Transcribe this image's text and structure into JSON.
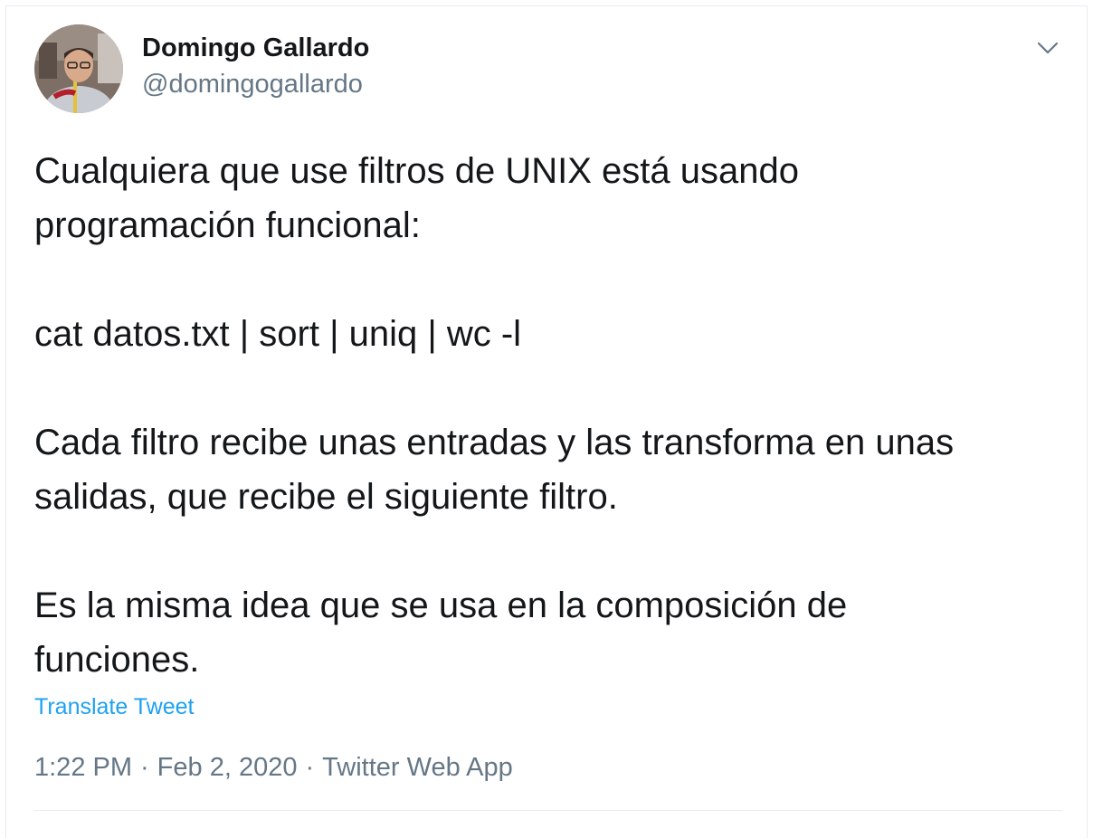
{
  "author": {
    "name": "Domingo Gallardo",
    "handle": "@domingogallardo"
  },
  "tweet": {
    "paragraphs": [
      [
        "Cualquiera que use filtros de UNIX está usando",
        "programación funcional:"
      ],
      [
        "cat datos.txt | sort | uniq | wc -l"
      ],
      [
        "Cada filtro recibe unas entradas y las transforma en unas",
        "salidas, que recibe el siguiente filtro."
      ],
      [
        "Es la misma idea que se usa en la composición de",
        "funciones."
      ]
    ],
    "translate_label": "Translate Tweet"
  },
  "meta": {
    "time": "1:22 PM",
    "date": "Feb 2, 2020",
    "source": "Twitter Web App",
    "separator": "·"
  },
  "icons": {
    "caret": "chevron-down-icon"
  },
  "colors": {
    "link": "#1da1f2",
    "secondary_text": "#657786",
    "primary_text": "#14171a",
    "border": "#e6ecf0"
  }
}
